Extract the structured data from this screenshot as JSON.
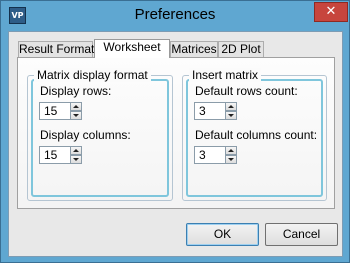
{
  "window": {
    "title": "Preferences",
    "icon_text": "VP",
    "close_glyph": "✕"
  },
  "tabs": [
    {
      "label": "Result Format"
    },
    {
      "label": "Worksheet",
      "selected": true
    },
    {
      "label": "Matrices"
    },
    {
      "label": "2D Plot"
    }
  ],
  "matrix_display": {
    "title": "Matrix display format",
    "rows_label": "Display rows:",
    "rows_value": "15",
    "columns_label": "Display columns:",
    "columns_value": "15"
  },
  "insert_matrix": {
    "title": "Insert matrix",
    "rows_label": "Default rows count:",
    "rows_value": "3",
    "columns_label": "Default columns count:",
    "columns_value": "3"
  },
  "buttons": {
    "ok": "OK",
    "cancel": "Cancel"
  },
  "colors": {
    "frame": "#5fa7d1",
    "close": "#c7453d",
    "group_highlight": "#7fc6dc"
  }
}
